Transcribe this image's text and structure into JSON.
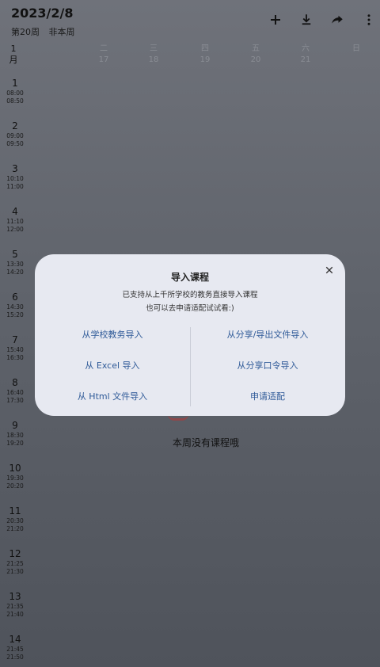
{
  "header": {
    "date": "2023/2/8",
    "week": "第20周",
    "week_state": "非本周",
    "actions": [
      {
        "name": "add-icon"
      },
      {
        "name": "download-icon"
      },
      {
        "name": "share-icon"
      },
      {
        "name": "more-vert-icon"
      }
    ]
  },
  "week_header": {
    "month_num": "1",
    "month_label": "月",
    "days": [
      {
        "name": "二",
        "date": "17"
      },
      {
        "name": "三",
        "date": "18"
      },
      {
        "name": "四",
        "date": "19"
      },
      {
        "name": "五",
        "date": "20"
      },
      {
        "name": "六",
        "date": "21"
      },
      {
        "name": "日",
        "date": ""
      }
    ]
  },
  "slots": [
    {
      "num": "1",
      "start": "08:00",
      "end": "08:50"
    },
    {
      "num": "2",
      "start": "09:00",
      "end": "09:50"
    },
    {
      "num": "3",
      "start": "10:10",
      "end": "11:00"
    },
    {
      "num": "4",
      "start": "11:10",
      "end": "12:00"
    },
    {
      "num": "5",
      "start": "13:30",
      "end": "14:20"
    },
    {
      "num": "6",
      "start": "14:30",
      "end": "15:20"
    },
    {
      "num": "7",
      "start": "15:40",
      "end": "16:30"
    },
    {
      "num": "8",
      "start": "16:40",
      "end": "17:30"
    },
    {
      "num": "9",
      "start": "18:30",
      "end": "19:20"
    },
    {
      "num": "10",
      "start": "19:30",
      "end": "20:20"
    },
    {
      "num": "11",
      "start": "20:30",
      "end": "21:20"
    },
    {
      "num": "12",
      "start": "21:25",
      "end": "21:30"
    },
    {
      "num": "13",
      "start": "21:35",
      "end": "21:40"
    },
    {
      "num": "14",
      "start": "21:45",
      "end": "21:50"
    }
  ],
  "empty_message": "本周没有课程哦",
  "dialog": {
    "title": "导入课程",
    "subtitle_1": "已支持从上千所学校的教务直接导入课程",
    "subtitle_2": "也可以去申请适配试试看:)",
    "close_icon": "close-icon",
    "options_left": [
      "从学校教务导入",
      "从 Excel 导入",
      "从 Html 文件导入"
    ],
    "options_right": [
      "从分享/导出文件导入",
      "从分享口令导入",
      "申请适配"
    ]
  }
}
